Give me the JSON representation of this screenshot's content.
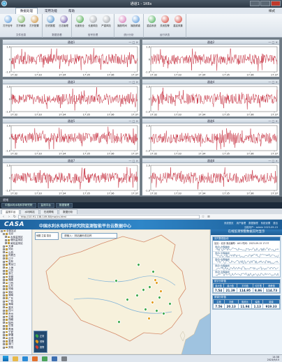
{
  "app": {
    "title": "通道1 - 1K6s",
    "menu_tabs": [
      "数据处理",
      "常用功能",
      "帮助"
    ],
    "active_tab": "数据处理",
    "style_label": "样式",
    "ribbon_groups": [
      {
        "label": "文件信息",
        "buttons": [
          {
            "label": "打开信号",
            "icon": "open-file-icon",
            "color": "#4a90d9"
          },
          {
            "label": "打开解析",
            "icon": "parse-icon",
            "color": "#6aa84f"
          },
          {
            "label": "打开配置",
            "icon": "config-icon",
            "color": "#c98a2e"
          }
        ]
      },
      {
        "label": "数据查看",
        "buttons": [
          {
            "label": "历史数据",
            "icon": "history-icon",
            "color": "#3d85c6"
          },
          {
            "label": "日志管理",
            "icon": "log-icon",
            "color": "#674ea7"
          }
        ]
      },
      {
        "label": "信号处理",
        "buttons": [
          {
            "label": "长度安全",
            "icon": "safety-icon",
            "color": "#38a03a"
          },
          {
            "label": "长度风险",
            "icon": "risk-icon",
            "color": "#9aa0a6"
          },
          {
            "label": "严重风险",
            "icon": "danger-icon",
            "color": "#9aa0a6"
          }
        ]
      },
      {
        "label": "统计分析",
        "buttons": [
          {
            "label": "播放时间",
            "icon": "play-icon",
            "color": "#d06ab0"
          },
          {
            "label": "播放频谱",
            "icon": "spectrum-icon",
            "color": "#4a90d9"
          }
        ]
      },
      {
        "label": "运行状态",
        "buttons": [
          {
            "label": "重启系统",
            "icon": "restart-icon",
            "color": "#3aa84a"
          },
          {
            "label": "关闭告警",
            "icon": "close-alarm-icon",
            "color": "#d23b2f"
          },
          {
            "label": "重启采集",
            "icon": "restart-acq-icon",
            "color": "#d23b2f"
          }
        ]
      }
    ],
    "panels": [
      {
        "title": "通道1",
        "times": [
          "17:32",
          "17:33",
          "17:34",
          "17:35",
          "17:36",
          "17:37"
        ],
        "yticks": [
          "1.0",
          "0",
          "-1.0"
        ]
      },
      {
        "title": "通道2",
        "times": [
          "17:32",
          "17:33",
          "17:34",
          "17:35",
          "17:36",
          "17:37"
        ],
        "yticks": [
          "1.0",
          "0",
          "-1.0"
        ]
      },
      {
        "title": "通道3",
        "times": [
          "17:32",
          "17:33",
          "17:34",
          "17:35",
          "17:36",
          "17:37"
        ],
        "yticks": [
          "1.0",
          "0",
          "-1.0"
        ]
      },
      {
        "title": "通道4",
        "times": [
          "17:32",
          "17:33",
          "17:34",
          "17:35",
          "17:36",
          "17:37"
        ],
        "yticks": [
          "1.0",
          "0",
          "-1.0"
        ]
      },
      {
        "title": "通道5",
        "times": [
          "17:32",
          "17:33",
          "17:34",
          "17:35",
          "17:36",
          "17:37"
        ],
        "yticks": [
          "1.0",
          "0",
          "-1.0"
        ]
      },
      {
        "title": "通道6",
        "times": [
          "17:32",
          "17:33",
          "17:34",
          "17:35",
          "17:36",
          "17:37"
        ],
        "yticks": [
          "1.0",
          "0",
          "-1.0"
        ]
      },
      {
        "title": "通道7",
        "times": [
          "17:32",
          "17:33",
          "17:34",
          "17:35",
          "17:36",
          "17:37"
        ],
        "yticks": [
          "1.0",
          "0",
          "-1.0"
        ]
      },
      {
        "title": "通道8",
        "times": [
          "17:32",
          "17:33",
          "17:34",
          "17:35",
          "17:36",
          "17:37"
        ],
        "yticks": [
          "1.0",
          "0",
          "-1.0"
        ]
      }
    ],
    "status": "就绪",
    "signal_color": "#c0182a"
  },
  "taskbar_items": [
    "中国水利水电科学研究院",
    "监测平台",
    "数据管理"
  ],
  "browser": {
    "tabs": [
      "监测平台",
      "水利网站",
      "在线帮助",
      "数据分析"
    ],
    "url": "http://10.91.138.149.80/mw/cs.html",
    "site": {
      "logo": "CASA",
      "title": "中国水利水电科学研究院监测智能平台云数据中心",
      "links": [
        "系统首页",
        "用户管理",
        "数据管理",
        "系统设置",
        "退出"
      ],
      "user": "当前用户：admin  2023-09-15"
    },
    "tree": [
      {
        "label": "全部站点",
        "depth": 0,
        "box": "-"
      },
      {
        "label": "北京",
        "depth": 1,
        "box": "-"
      },
      {
        "label": "水库监测站",
        "depth": 2,
        "box": "+"
      },
      {
        "label": "堤防监测站",
        "depth": 2,
        "box": "+"
      },
      {
        "label": "闸站监测站",
        "depth": 2,
        "box": "+"
      },
      {
        "label": "天津",
        "depth": 1,
        "box": "+"
      },
      {
        "label": "河北",
        "depth": 1,
        "box": "+"
      },
      {
        "label": "山西",
        "depth": 1,
        "box": "+"
      },
      {
        "label": "内蒙古",
        "depth": 1,
        "box": "+"
      },
      {
        "label": "辽宁",
        "depth": 1,
        "box": "+"
      },
      {
        "label": "吉林",
        "depth": 1,
        "box": "+"
      },
      {
        "label": "黑龙江",
        "depth": 1,
        "box": "+"
      },
      {
        "label": "上海",
        "depth": 1,
        "box": "+"
      },
      {
        "label": "江苏",
        "depth": 1,
        "box": "+"
      },
      {
        "label": "浙江",
        "depth": 1,
        "box": "+"
      },
      {
        "label": "安徽",
        "depth": 1,
        "box": "+"
      },
      {
        "label": "福建",
        "depth": 1,
        "box": "+"
      },
      {
        "label": "江西",
        "depth": 1,
        "box": "+"
      },
      {
        "label": "山东",
        "depth": 1,
        "box": "+"
      },
      {
        "label": "河南",
        "depth": 1,
        "box": "+"
      },
      {
        "label": "湖北",
        "depth": 1,
        "box": "+"
      },
      {
        "label": "湖南",
        "depth": 1,
        "box": "+"
      },
      {
        "label": "广东",
        "depth": 1,
        "box": "+"
      },
      {
        "label": "广西",
        "depth": 1,
        "box": "+"
      },
      {
        "label": "海南",
        "depth": 1,
        "box": "+"
      },
      {
        "label": "重庆",
        "depth": 1,
        "box": "+"
      },
      {
        "label": "四川",
        "depth": 1,
        "box": "+"
      },
      {
        "label": "贵州",
        "depth": 1,
        "box": "+"
      },
      {
        "label": "云南",
        "depth": 1,
        "box": "+"
      },
      {
        "label": "西藏",
        "depth": 1,
        "box": "+"
      },
      {
        "label": "陕西",
        "depth": 1,
        "box": "+"
      },
      {
        "label": "甘肃",
        "depth": 1,
        "box": "+"
      },
      {
        "label": "青海",
        "depth": 1,
        "box": "+"
      },
      {
        "label": "宁夏",
        "depth": 1,
        "box": "+"
      },
      {
        "label": "新疆",
        "depth": 1,
        "box": "+"
      },
      {
        "label": "台湾",
        "depth": 1,
        "box": "+"
      },
      {
        "label": "香港",
        "depth": 1,
        "box": "+"
      },
      {
        "label": "澳门",
        "depth": 1,
        "box": "+"
      },
      {
        "label": "其他",
        "depth": 1,
        "box": "+"
      }
    ],
    "map": {
      "search_placeholder": "请输入：测站编码或名称",
      "tools": "地图  卫星  混合",
      "legend": [
        {
          "label": "正常",
          "color": "#3aa84a"
        },
        {
          "label": "预警",
          "color": "#e39a1b"
        },
        {
          "label": "报警",
          "color": "#d23b2f"
        }
      ],
      "sea_color": "#9fc3e0",
      "land_color": "#f3efe4"
    },
    "right": {
      "title": "在线监测预警数据实时显示",
      "section1": "实时数据曲线",
      "info": "站点：北京 测点编号：A01  时间：2023-09-15 17:37",
      "minis": [
        "测点1 时程曲线",
        "测点2 时程曲线",
        "测点3 时程曲线",
        "测点4 时程曲线",
        "测点5 时程曲线"
      ],
      "table1_title": "统计分析值",
      "table1_headers": [
        "最大值",
        "最小值",
        "平均值",
        "均方根",
        "峰峰值"
      ],
      "table1_values": [
        "7.54",
        "21.39",
        "114.95",
        "8.86",
        "114.73"
      ],
      "table2_title": "频谱分析值",
      "table2_headers": [
        "主频",
        "次频",
        "阻尼比",
        "幅值",
        "能量"
      ],
      "table2_values": [
        "7.56",
        "20.13",
        "11.94",
        "1.13",
        "919.33"
      ]
    }
  },
  "system": {
    "time": "14:38",
    "date": "2023/9/15"
  }
}
